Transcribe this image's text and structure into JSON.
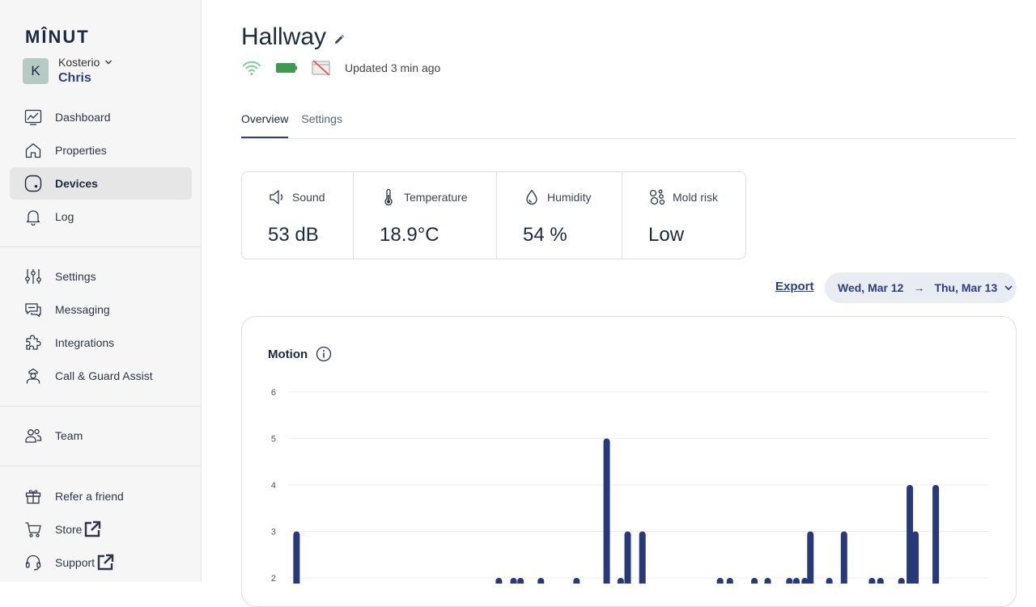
{
  "sidebar": {
    "logo": "MÎNUT",
    "org": {
      "initial": "K",
      "name": "Kosterio",
      "user": "Chris"
    },
    "nav_main": [
      {
        "label": "Dashboard",
        "icon": "chart-icon"
      },
      {
        "label": "Properties",
        "icon": "home-icon"
      },
      {
        "label": "Devices",
        "icon": "device-icon",
        "active": true
      },
      {
        "label": "Log",
        "icon": "bell-icon"
      }
    ],
    "nav_config": [
      {
        "label": "Settings",
        "icon": "sliders-icon"
      },
      {
        "label": "Messaging",
        "icon": "message-icon"
      },
      {
        "label": "Integrations",
        "icon": "puzzle-icon"
      },
      {
        "label": "Call & Guard Assist",
        "icon": "guard-icon"
      }
    ],
    "nav_team": [
      {
        "label": "Team",
        "icon": "team-icon"
      }
    ],
    "nav_bottom": [
      {
        "label": "Refer a friend",
        "icon": "gift-icon"
      },
      {
        "label": "Store",
        "icon": "cart-icon",
        "external": true
      },
      {
        "label": "Support",
        "icon": "headset-icon",
        "external": true
      }
    ]
  },
  "device": {
    "name": "Hallway",
    "updated": "Updated 3 min ago",
    "wifi_color": "#7fcf9a",
    "battery_color": "#3e9a4f"
  },
  "tabs": [
    {
      "label": "Overview",
      "active": true
    },
    {
      "label": "Settings",
      "active": false
    }
  ],
  "stats": [
    {
      "label": "Sound",
      "value": "53 dB",
      "icon": "speaker-icon"
    },
    {
      "label": "Temperature",
      "value": "18.9°C",
      "icon": "thermometer-icon"
    },
    {
      "label": "Humidity",
      "value": "54 %",
      "icon": "droplet-icon"
    },
    {
      "label": "Mold risk",
      "value": "Low",
      "icon": "mold-icon"
    }
  ],
  "export_label": "Export",
  "date_range": {
    "from": "Wed, Mar 12",
    "arrow": "→",
    "to": "Thu, Mar 13"
  },
  "chart_title": "Motion",
  "colors": {
    "accent": "#2a3f80",
    "bar": "#27397a"
  },
  "chart_data": {
    "type": "bar",
    "title": "Motion",
    "ytick_labels": [
      "2",
      "3",
      "4",
      "5",
      "6"
    ],
    "ylim": [
      0,
      6
    ],
    "grid": true,
    "x": [
      0.012,
      0.301,
      0.322,
      0.332,
      0.361,
      0.412,
      0.455,
      0.475,
      0.485,
      0.506,
      0.617,
      0.631,
      0.666,
      0.685,
      0.716,
      0.726,
      0.738,
      0.746,
      0.773,
      0.794,
      0.834,
      0.846,
      0.876,
      0.888,
      0.896,
      0.925
    ],
    "values": [
      3,
      2,
      2,
      2,
      2,
      2,
      5,
      2,
      3,
      3,
      2,
      2,
      2,
      2,
      2,
      2,
      2,
      3,
      2,
      3,
      2,
      2,
      2,
      4,
      3,
      4
    ],
    "xlim": [
      0,
      1
    ]
  }
}
